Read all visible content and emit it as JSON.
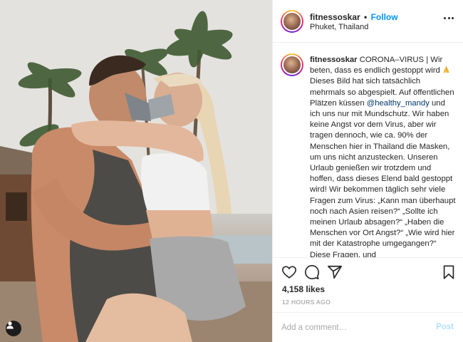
{
  "post": {
    "username": "fitnessoskar",
    "follow_label": "Follow",
    "location": "Phuket, Thailand",
    "caption": {
      "author": "fitnessoskar",
      "text_part1": " CORONA–VIRUS | Wir beten, dass es endlich gestoppt wird ",
      "emoji_icon": "folded-hands-icon",
      "text_part2": " Dieses Bild hat sich tatsächlich mehrmals so abgespielt. Auf öffentlichen Plätzen küssen ",
      "mention": "@healthy_mandy",
      "text_part3": " und ich uns nur mit Mundschutz. Wir haben keine Angst vor dem Virus, aber wir tragen dennoch, wie ca. 90% der Menschen hier in Thailand die Masken, um uns nicht anzustecken. Unseren Urlaub genießen wir trotzdem und hoffen, dass dieses Elend bald gestoppt wird! Wir bekommen täglich sehr viele Fragen zum Virus: „Kann man überhaupt noch nach Asien reisen?“ „Sollte ich meinen Urlaub absagen?“ „Haben die Menschen vor Ort Angst?“ „Wie wird hier mit der Katastrophe umgegangen?“ Diese Fragen, und"
    },
    "likes": "4,158 likes",
    "timestamp": "12 HOURS AGO",
    "comment_placeholder": "Add a comment…",
    "post_label": "Post"
  },
  "colors": {
    "link_blue": "#0095f6",
    "post_disabled": "#b2dffc",
    "mention": "#00376b"
  }
}
